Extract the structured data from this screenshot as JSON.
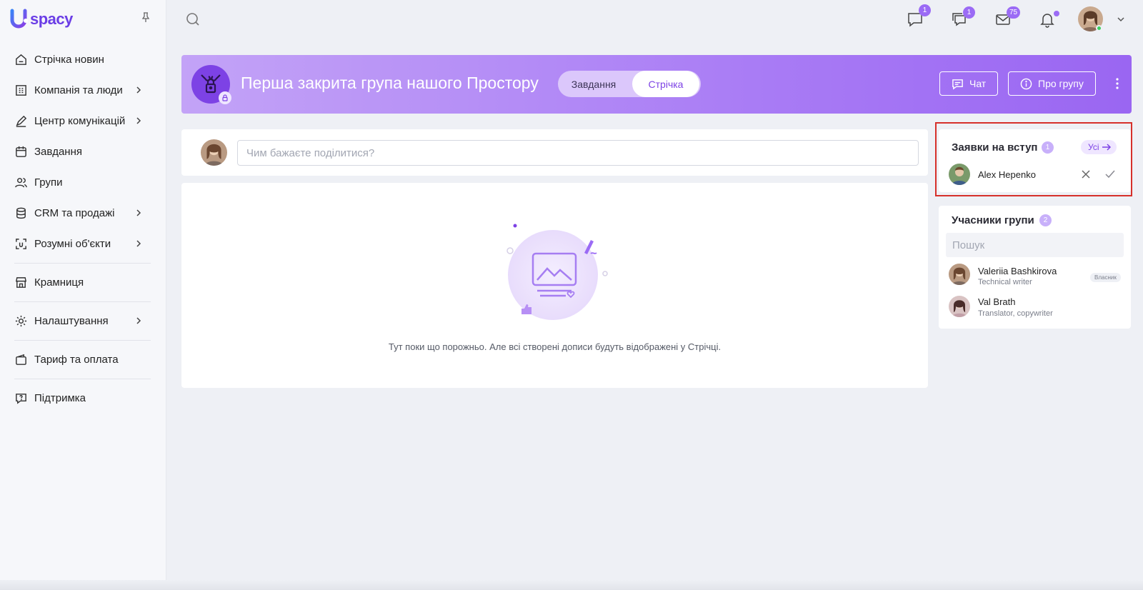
{
  "app": {
    "logo_text": "spacy",
    "logo_letter": "U"
  },
  "sidebar": {
    "items": [
      {
        "label": "Стрічка новин",
        "icon": "home-icon",
        "has_children": false
      },
      {
        "label": "Компанія та люди",
        "icon": "building-icon",
        "has_children": true
      },
      {
        "label": "Центр комунікацій",
        "icon": "edit-communication-icon",
        "has_children": true
      },
      {
        "label": "Завдання",
        "icon": "calendar-icon",
        "has_children": false
      },
      {
        "label": "Групи",
        "icon": "users-icon",
        "has_children": false
      },
      {
        "label": "CRM та продажі",
        "icon": "database-icon",
        "has_children": true
      },
      {
        "label": "Розумні об'єкти",
        "icon": "scan-icon",
        "has_children": true
      },
      {
        "label": "Крамниця",
        "icon": "store-icon",
        "has_children": false
      },
      {
        "label": "Налаштування",
        "icon": "gear-icon",
        "has_children": true
      },
      {
        "label": "Тариф та оплата",
        "icon": "wallet-icon",
        "has_children": false
      },
      {
        "label": "Підтримка",
        "icon": "help-icon",
        "has_children": false
      }
    ]
  },
  "topbar": {
    "chat_badge": "1",
    "messages_badge": "1",
    "mail_badge": "75",
    "accent": "#9b6bf5"
  },
  "group": {
    "title": "Перша закрита група нашого Простору",
    "tabs": [
      "Завдання",
      "Стрічка"
    ],
    "active_tab": "Стрічка",
    "chat_button": "Чат",
    "about_button": "Про групу"
  },
  "composer": {
    "placeholder": "Чим бажаєте поділитися?"
  },
  "feed": {
    "empty_text": "Тут поки що порожньо. Але всі створені дописи будуть відображені у Стрічці."
  },
  "requests": {
    "title": "Заявки на вступ",
    "count": "1",
    "all_label": "Усі",
    "items": [
      {
        "name": "Alex Hepenko"
      }
    ]
  },
  "members": {
    "title": "Учасники групи",
    "count": "2",
    "search_placeholder": "Пошук",
    "items": [
      {
        "name": "Valeriia Bashkirova",
        "role": "Technical writer",
        "tag": "Власник"
      },
      {
        "name": "Val Brath",
        "role": "Translator, copywriter",
        "tag": ""
      }
    ]
  }
}
